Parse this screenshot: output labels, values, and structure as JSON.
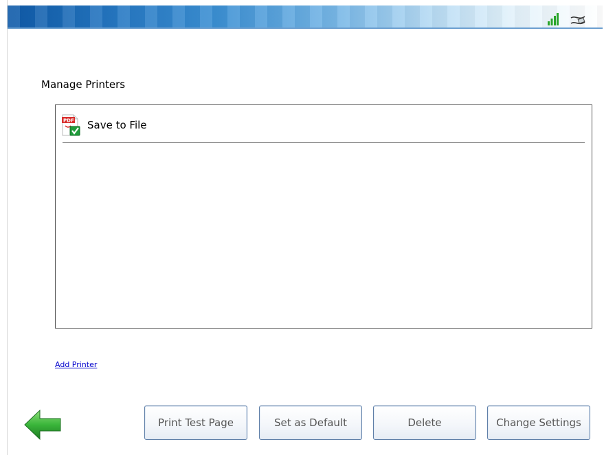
{
  "header": {
    "signal_icon": "signal-bars-icon",
    "network_icon": "ethernet-cable-icon",
    "accent_color": "#2577c2"
  },
  "page": {
    "title": "Manage Printers"
  },
  "printers": [
    {
      "name": "Save to File",
      "icon": "pdf-printer-default-icon"
    }
  ],
  "links": {
    "add_printer": "Add Printer"
  },
  "buttons": {
    "back_icon": "green-back-arrow-icon",
    "print_test_page": "Print Test Page",
    "set_as_default": "Set as Default",
    "delete": "Delete",
    "change_settings": "Change Settings"
  }
}
